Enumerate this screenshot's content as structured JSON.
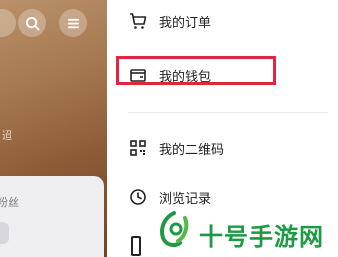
{
  "left": {
    "faded_text_1": "迢",
    "faded_text_2": "粉丝",
    "card_label": "丝"
  },
  "menu": {
    "items": [
      {
        "label": "我的订单",
        "icon": "cart-icon"
      },
      {
        "label": "我的钱包",
        "icon": "wallet-icon"
      },
      {
        "label": "我的二维码",
        "icon": "qrcode-icon"
      },
      {
        "label": "浏览记录",
        "icon": "clock-icon"
      }
    ]
  },
  "watermark": {
    "text": "十号手游网"
  },
  "colors": {
    "highlight": "#e3263f",
    "watermark": "#1d9a43"
  }
}
